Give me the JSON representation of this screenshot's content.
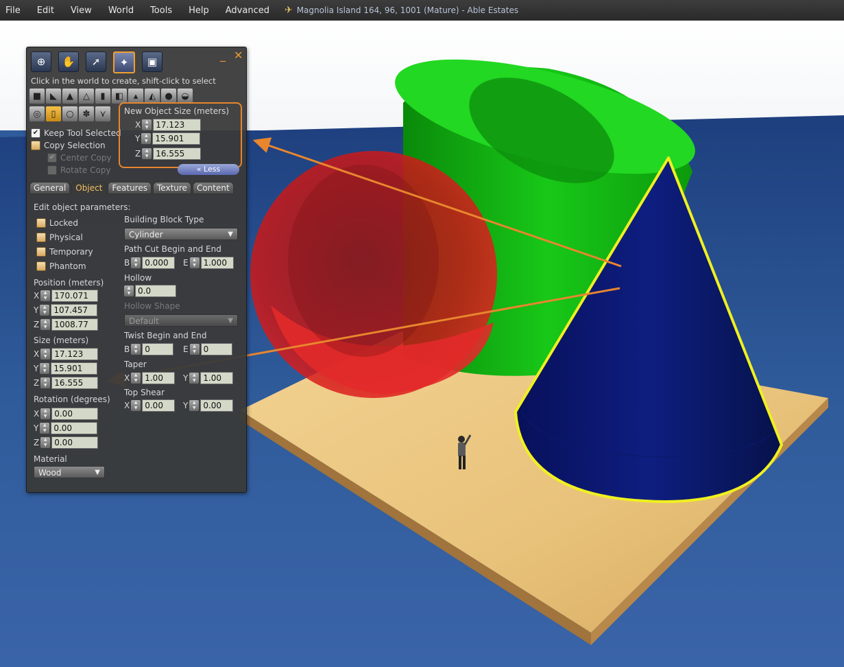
{
  "menubar": {
    "items": [
      "File",
      "Edit",
      "View",
      "World",
      "Tools",
      "Help",
      "Advanced"
    ],
    "location": "Magnolia Island 164, 96, 1001 (Mature) - Able Estates"
  },
  "tools_panel": {
    "window_controls": {
      "minimize": "_",
      "close": "✕"
    },
    "tool_buttons": [
      "focus-tool",
      "grab-tool",
      "select-tool",
      "create-tool",
      "land-tool"
    ],
    "hint": "Click in the world to create, shift-click to select",
    "new_object_size": {
      "title": "New Object Size (meters)",
      "x": "17.123",
      "y": "15.901",
      "z": "16.555"
    },
    "options": {
      "keep_tool_selected": "Keep Tool Selected",
      "copy_selection": "Copy Selection",
      "center_copy": "Center Copy",
      "rotate_copy": "Rotate Copy"
    },
    "less_button": "« Less",
    "tabs": [
      "General",
      "Object",
      "Features",
      "Texture",
      "Content"
    ],
    "object": {
      "heading": "Edit object parameters:",
      "checkboxes": [
        "Locked",
        "Physical",
        "Temporary",
        "Phantom"
      ],
      "position_label": "Position (meters)",
      "position": {
        "x": "170.071",
        "y": "107.457",
        "z": "1008.77"
      },
      "size_label": "Size (meters)",
      "size": {
        "x": "17.123",
        "y": "15.901",
        "z": "16.555"
      },
      "rotation_label": "Rotation (degrees)",
      "rotation": {
        "x": "0.00",
        "y": "0.00",
        "z": "0.00"
      },
      "material_label": "Material",
      "material": "Wood",
      "building_block_label": "Building Block Type",
      "building_block": "Cylinder",
      "path_cut_label": "Path Cut Begin and End",
      "path_cut": {
        "b": "0.000",
        "e": "1.000"
      },
      "hollow_label": "Hollow",
      "hollow": "0.0",
      "hollow_shape_label": "Hollow Shape",
      "hollow_shape": "Default",
      "twist_label": "Twist Begin and End",
      "twist": {
        "b": "0",
        "e": "0"
      },
      "taper_label": "Taper",
      "taper": {
        "x": "1.00",
        "y": "1.00"
      },
      "top_shear_label": "Top Shear",
      "top_shear": {
        "x": "0.00",
        "y": "0.00"
      }
    },
    "axis_letters": {
      "x": "X",
      "y": "Y",
      "z": "Z",
      "b": "B",
      "e": "E"
    }
  },
  "colors": {
    "accent": "#e8862e",
    "sea": "#2f5b9a",
    "sky": "#ffffff",
    "platform": "#e8c27a",
    "cylinder": "#12c012",
    "sphere": "#d81818",
    "cone": "#0a1a70",
    "cone_outline": "#f0f020"
  }
}
